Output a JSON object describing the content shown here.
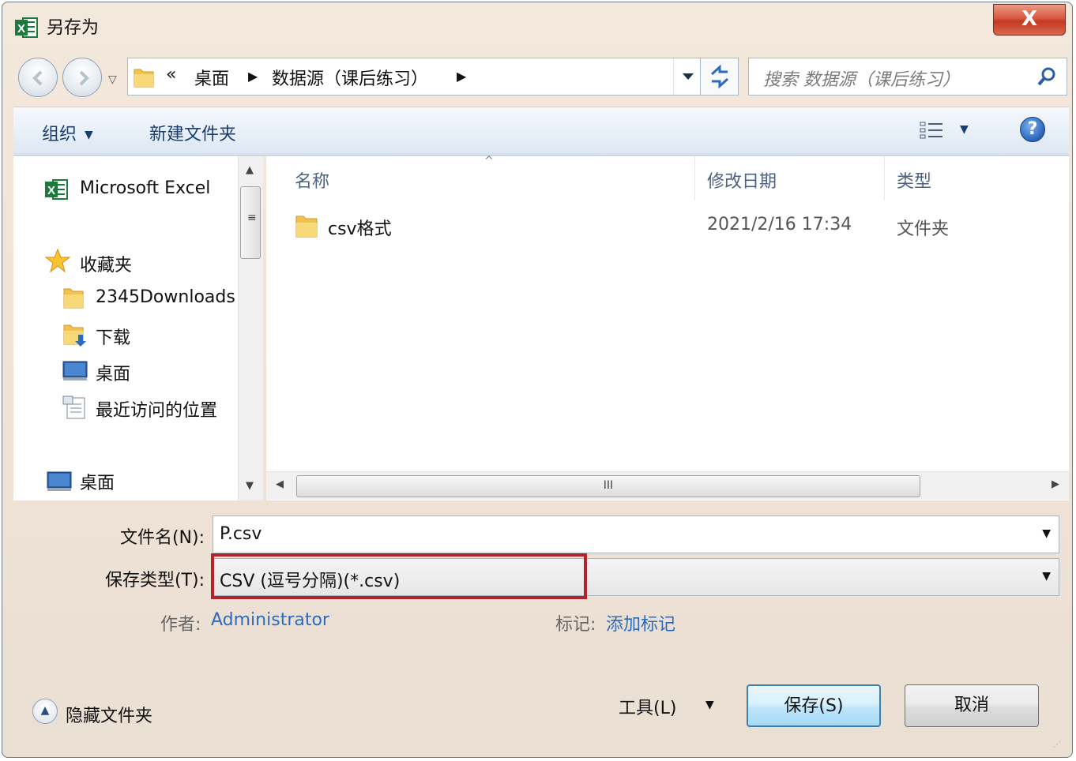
{
  "window": {
    "title": "另存为",
    "close_label": "X"
  },
  "address": {
    "overflow": "«",
    "crumbs": [
      "桌面",
      "数据源（课后练习）"
    ],
    "search_placeholder": "搜索 数据源（课后练习）"
  },
  "toolbar": {
    "organize": "组织",
    "new_folder": "新建文件夹",
    "help": "?"
  },
  "navpane": {
    "app": "Microsoft Excel",
    "favorites": "收藏夹",
    "items": [
      "2345Downloads",
      "下载",
      "桌面",
      "最近访问的位置"
    ],
    "desktop": "桌面"
  },
  "filelist": {
    "columns": {
      "name": "名称",
      "date": "修改日期",
      "type": "类型"
    },
    "rows": [
      {
        "name": "csv格式",
        "date": "2021/2/16 17:34",
        "type": "文件夹"
      }
    ]
  },
  "form": {
    "filename_label": "文件名(N):",
    "filename_value": "P.csv",
    "filetype_label": "保存类型(T):",
    "filetype_value": "CSV (逗号分隔)(*.csv)",
    "author_label": "作者:",
    "author_value": "Administrator",
    "tags_label": "标记:",
    "tags_value": "添加标记"
  },
  "footer": {
    "hide_folders": "隐藏文件夹",
    "tools": "工具(L)",
    "save": "保存(S)",
    "cancel": "取消"
  },
  "colors": {
    "highlight": "#b3232a",
    "link": "#2a6bbf",
    "excel_green": "#1d7a3d"
  }
}
